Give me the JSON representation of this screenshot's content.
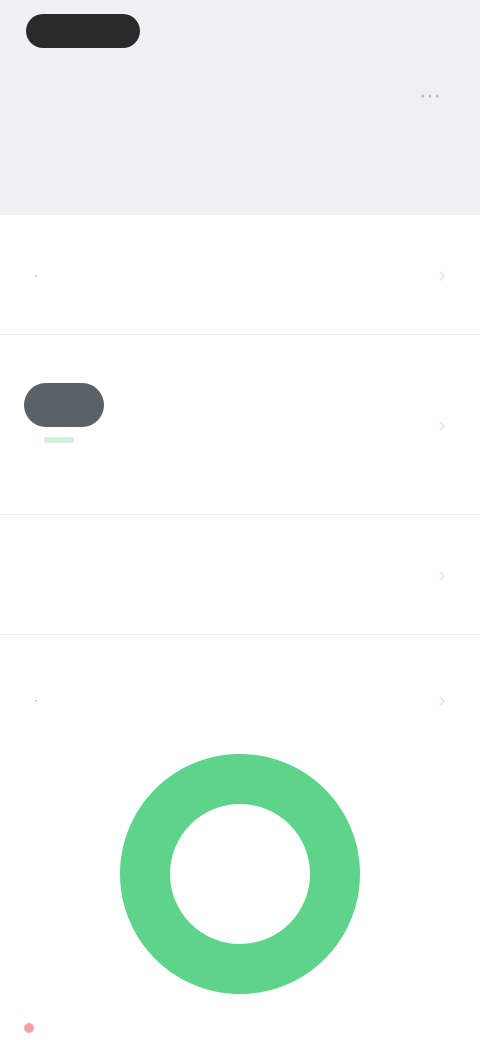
{
  "status_bar": {
    "time": "",
    "indicators": ""
  },
  "header": {
    "action_icon": "more-icon",
    "title": ""
  },
  "list": {
    "items": [
      {
        "label": "",
        "icon": "row-lead-icon",
        "chevron": "chevron-right-icon"
      },
      {
        "chip": "",
        "chevron": "chevron-right-icon"
      },
      {
        "label": "",
        "chevron": "chevron-right-icon"
      },
      {
        "label": "",
        "icon": "row-lead-icon",
        "chevron": "chevron-right-icon"
      }
    ]
  },
  "progress_ring": {
    "center_text": "",
    "fraction": 1.0,
    "color": "#5dd48a"
  },
  "footer": {
    "left_label": "",
    "right_label": ""
  },
  "colors": {
    "accent": "#5dd48a",
    "header_bg": "#eef1f4"
  }
}
